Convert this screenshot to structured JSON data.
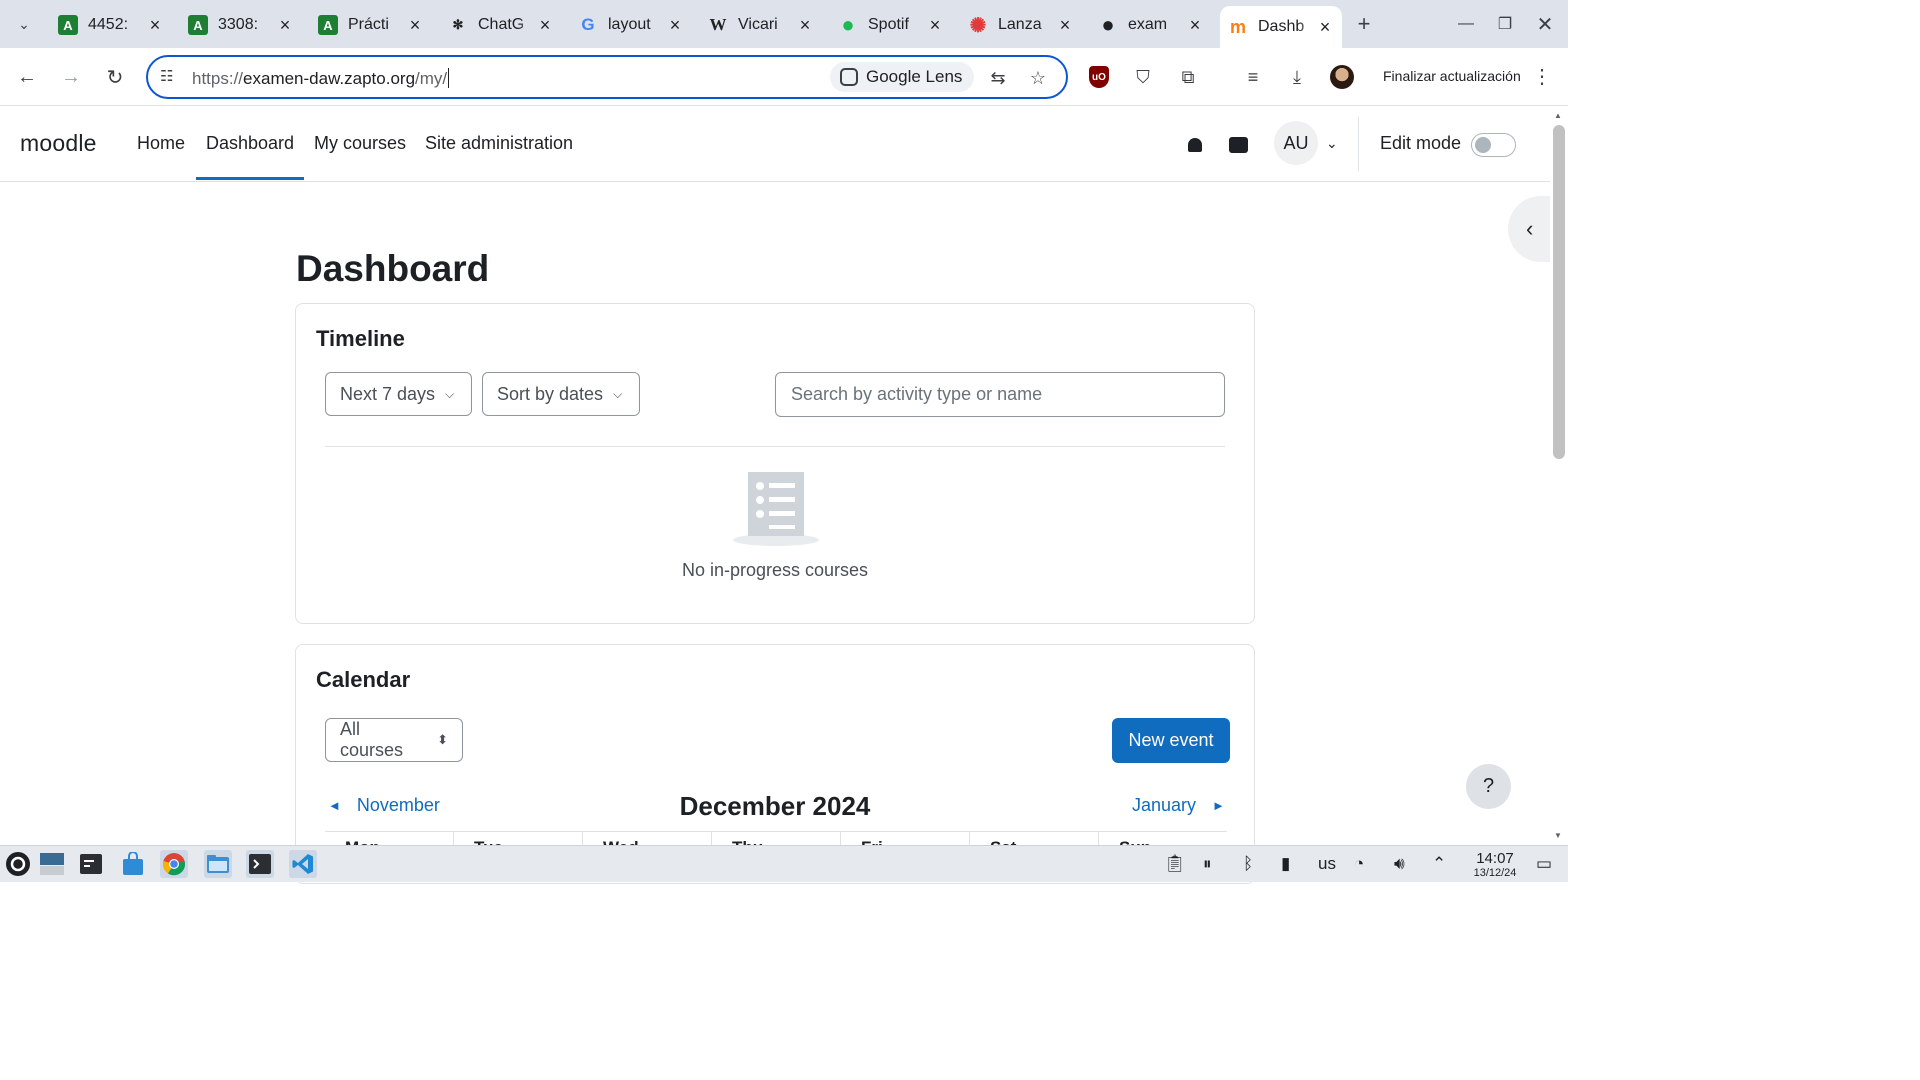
{
  "browser": {
    "tabs": [
      {
        "label": "4452:",
        "favicon": "A",
        "favicon_color": "#1e7e34"
      },
      {
        "label": "3308:",
        "favicon": "A",
        "favicon_color": "#1e7e34"
      },
      {
        "label": "Prácti",
        "favicon": "A",
        "favicon_color": "#1e7e34"
      },
      {
        "label": "ChatG",
        "favicon": "✻",
        "favicon_color": "#202124"
      },
      {
        "label": "layout",
        "favicon": "G",
        "favicon_color": "#4285f4"
      },
      {
        "label": "Vicari",
        "favicon": "W",
        "favicon_color": "#202124"
      },
      {
        "label": "Spotif",
        "favicon": "●",
        "favicon_color": "#1db954"
      },
      {
        "label": "Lanza",
        "favicon": "✺",
        "favicon_color": "#e03b3b"
      },
      {
        "label": "exam",
        "favicon": "●",
        "favicon_color": "#202124"
      },
      {
        "label": "Dashb",
        "favicon": "m",
        "favicon_color": "#f98012",
        "active": true
      }
    ],
    "url_prefix": "https://",
    "url_host": "examen-daw.zapto.org",
    "url_path": "/my/",
    "lens_label": "Google Lens",
    "update_label": "Finalizar actualización"
  },
  "moodle": {
    "logo": "moodle",
    "nav": {
      "home": "Home",
      "dashboard": "Dashboard",
      "my_courses": "My courses",
      "site_admin": "Site administration"
    },
    "user_initials": "AU",
    "edit_mode_label": "Edit mode",
    "edit_mode_on": false,
    "accent_color": "#0f6cbf"
  },
  "page": {
    "title": "Dashboard",
    "timeline": {
      "heading": "Timeline",
      "filter_days": "Next 7 days",
      "sort": "Sort by dates",
      "search_placeholder": "Search by activity type or name",
      "empty_text": "No in-progress courses"
    },
    "calendar": {
      "heading": "Calendar",
      "course_filter": "All courses",
      "new_event": "New event",
      "prev_month": "November",
      "current_month": "December 2024",
      "next_month": "January",
      "weekdays": [
        "Mon",
        "Tue",
        "Wed",
        "Thu",
        "Fri",
        "Sat",
        "Sun"
      ]
    },
    "help_label": "?"
  },
  "taskbar": {
    "keyboard_layout": "us",
    "time": "14:07",
    "date": "13/12/24"
  }
}
